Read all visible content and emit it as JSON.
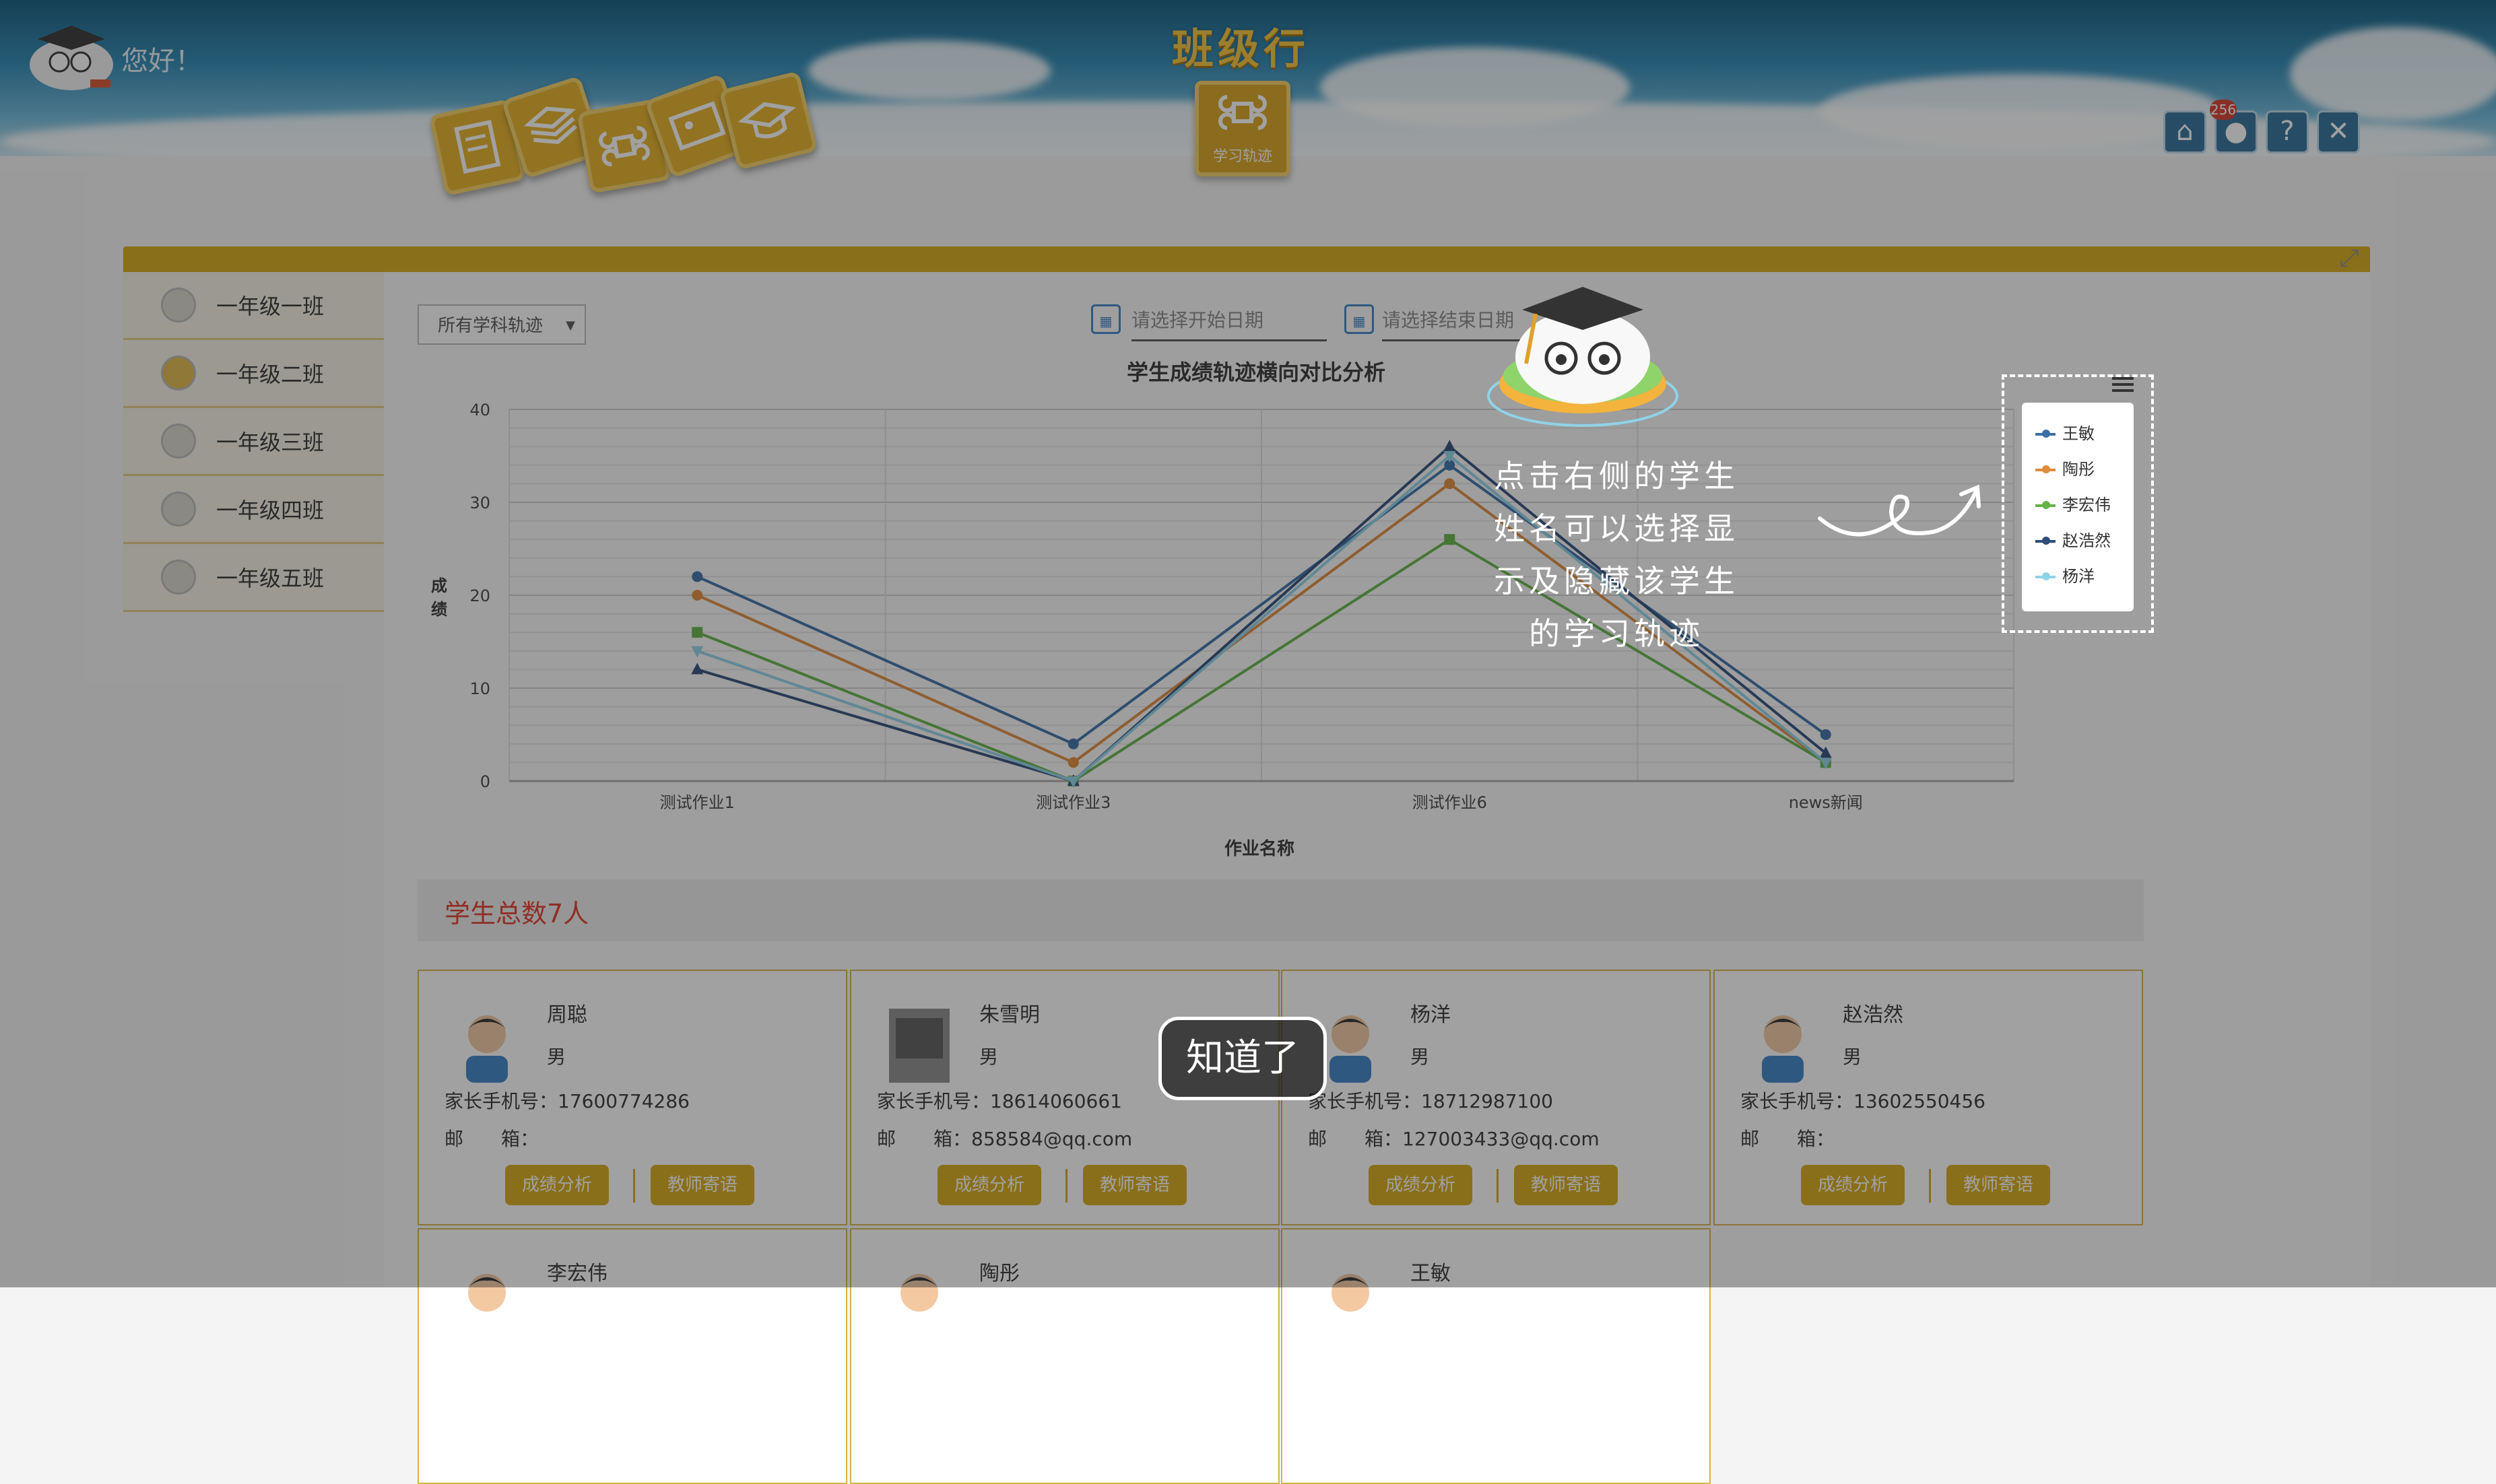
{
  "header": {
    "greeting": "您好！",
    "app_title": "班级行",
    "active_tab": "学习轨迹",
    "badge_count": "256"
  },
  "sidebar": {
    "items": [
      {
        "label": "一年级一班"
      },
      {
        "label": "一年级二班"
      },
      {
        "label": "一年级三班"
      },
      {
        "label": "一年级四班"
      },
      {
        "label": "一年级五班"
      }
    ]
  },
  "filters": {
    "subject_select": "所有学科轨迹",
    "start_date_placeholder": "请选择开始日期",
    "end_date_placeholder": "请选择结束日期"
  },
  "chart_data": {
    "type": "line",
    "title": "学生成绩轨迹横向对比分析",
    "xlabel": "作业名称",
    "ylabel": "成绩",
    "categories": [
      "测试作业1",
      "测试作业3",
      "测试作业6",
      "news新闻"
    ],
    "ylim": [
      0,
      40
    ],
    "yticks": [
      0,
      10,
      20,
      30,
      40
    ],
    "grid": true,
    "series": [
      {
        "name": "王敏",
        "color": "#3c6fa8",
        "marker": "circle",
        "values": [
          22,
          4,
          34,
          5
        ]
      },
      {
        "name": "陶彤",
        "color": "#e08a3a",
        "marker": "circle",
        "values": [
          20,
          2,
          32,
          2
        ]
      },
      {
        "name": "李宏伟",
        "color": "#62b447",
        "marker": "square",
        "values": [
          16,
          0,
          26,
          2
        ]
      },
      {
        "name": "赵浩然",
        "color": "#2f4d7a",
        "marker": "triangle",
        "values": [
          12,
          0,
          36,
          3
        ]
      },
      {
        "name": "杨洋",
        "color": "#8fd3e8",
        "marker": "triangle-down",
        "values": [
          14,
          0,
          35,
          2
        ]
      }
    ]
  },
  "students": {
    "total_label": "学生总数7人",
    "field_phone": "家长手机号：",
    "field_email": "邮　　箱：",
    "btn_score": "成绩分析",
    "btn_message": "教师寄语",
    "gender_male": "男",
    "cards": [
      {
        "name": "周聪",
        "gender": "男",
        "phone": "17600774286",
        "email": ""
      },
      {
        "name": "朱雪明",
        "gender": "男",
        "phone": "18614060661",
        "email": "858584@qq.com"
      },
      {
        "name": "杨洋",
        "gender": "男",
        "phone": "18712987100",
        "email": "127003433@qq.com"
      },
      {
        "name": "赵浩然",
        "gender": "男",
        "phone": "13602550456",
        "email": ""
      }
    ],
    "row2_names": [
      "李宏伟",
      "陶彤",
      "王敏"
    ]
  },
  "guide": {
    "lines": [
      "点击右侧的学生",
      "姓名可以选择显",
      "示及隐藏该学生",
      "的学习轨迹"
    ],
    "ok_button": "知道了"
  }
}
